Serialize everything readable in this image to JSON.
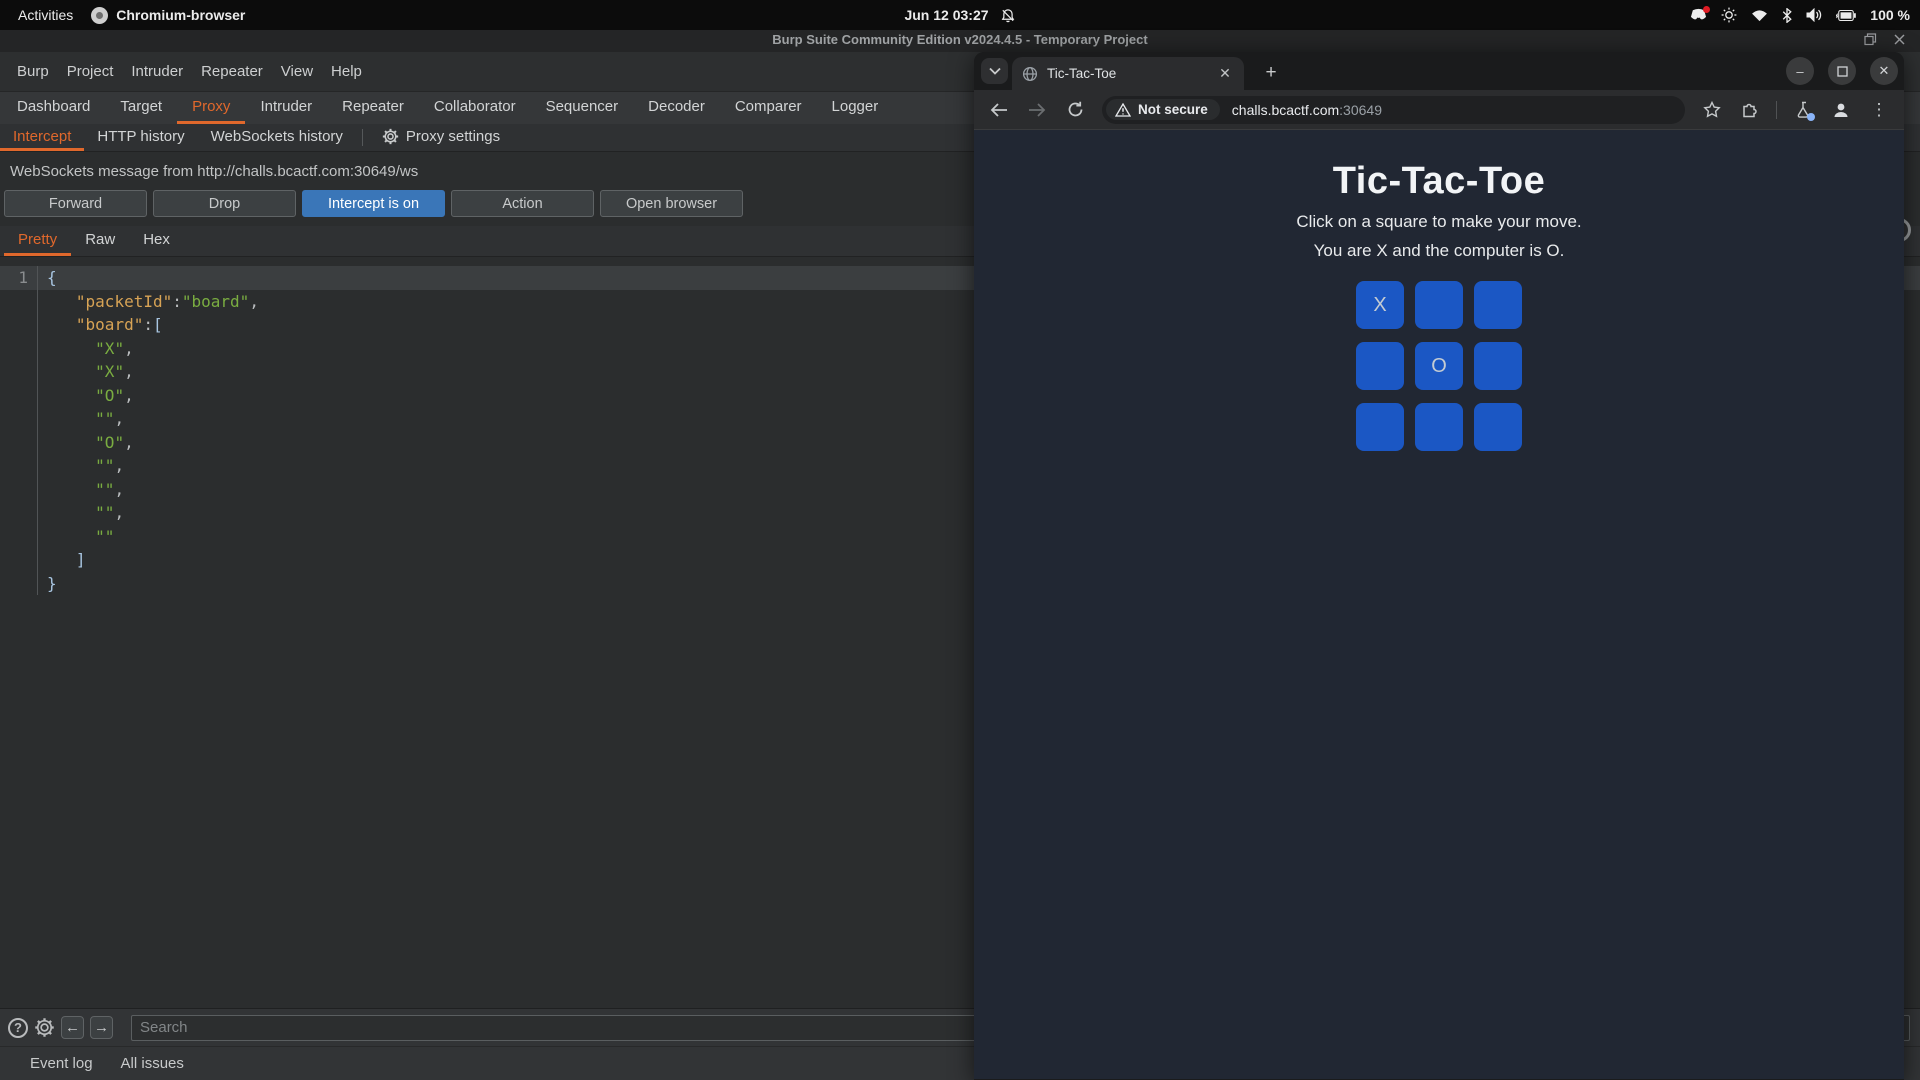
{
  "gnome_bar": {
    "activities": "Activities",
    "app_name": "Chromium-browser",
    "clock": "Jun 12 03:27",
    "battery_percent": "100 %"
  },
  "burp": {
    "window_title": "Burp Suite Community Edition v2024.4.5 - Temporary Project",
    "menu": [
      "Burp",
      "Project",
      "Intruder",
      "Repeater",
      "View",
      "Help"
    ],
    "main_tabs": [
      "Dashboard",
      "Target",
      "Proxy",
      "Intruder",
      "Repeater",
      "Collaborator",
      "Sequencer",
      "Decoder",
      "Comparer",
      "Logger"
    ],
    "active_main_tab": "Proxy",
    "sub_tabs": [
      "Intercept",
      "HTTP history",
      "WebSockets history"
    ],
    "active_sub_tab": "Intercept",
    "proxy_settings_label": "Proxy settings",
    "message_header": "WebSockets message from http://challs.bcactf.com:30649/ws",
    "buttons": {
      "forward": "Forward",
      "drop": "Drop",
      "intercept": "Intercept is on",
      "action": "Action",
      "open_browser": "Open browser"
    },
    "editor_tabs": [
      "Pretty",
      "Raw",
      "Hex"
    ],
    "active_editor_tab": "Pretty",
    "code": {
      "lines": [
        {
          "num": "1",
          "hl": true,
          "seg": [
            [
              "brace",
              "{"
            ]
          ]
        },
        {
          "seg": [
            [
              "sp",
              "   "
            ],
            [
              "key",
              "\"packetId\""
            ],
            [
              "punct",
              ":"
            ],
            [
              "str",
              "\"board\""
            ],
            [
              "punct",
              ","
            ]
          ]
        },
        {
          "seg": [
            [
              "sp",
              "   "
            ],
            [
              "key",
              "\"board\""
            ],
            [
              "punct",
              ":"
            ],
            [
              "bracket",
              "["
            ]
          ]
        },
        {
          "seg": [
            [
              "sp",
              "     "
            ],
            [
              "str",
              "\"X\""
            ],
            [
              "punct",
              ","
            ]
          ]
        },
        {
          "seg": [
            [
              "sp",
              "     "
            ],
            [
              "str",
              "\"X\""
            ],
            [
              "punct",
              ","
            ]
          ]
        },
        {
          "seg": [
            [
              "sp",
              "     "
            ],
            [
              "str",
              "\"O\""
            ],
            [
              "punct",
              ","
            ]
          ]
        },
        {
          "seg": [
            [
              "sp",
              "     "
            ],
            [
              "str",
              "\"\""
            ],
            [
              "punct",
              ","
            ]
          ]
        },
        {
          "seg": [
            [
              "sp",
              "     "
            ],
            [
              "str",
              "\"O\""
            ],
            [
              "punct",
              ","
            ]
          ]
        },
        {
          "seg": [
            [
              "sp",
              "     "
            ],
            [
              "str",
              "\"\""
            ],
            [
              "punct",
              ","
            ]
          ]
        },
        {
          "seg": [
            [
              "sp",
              "     "
            ],
            [
              "str",
              "\"\""
            ],
            [
              "punct",
              ","
            ]
          ]
        },
        {
          "seg": [
            [
              "sp",
              "     "
            ],
            [
              "str",
              "\"\""
            ],
            [
              "punct",
              ","
            ]
          ]
        },
        {
          "seg": [
            [
              "sp",
              "     "
            ],
            [
              "str",
              "\"\""
            ]
          ]
        },
        {
          "seg": [
            [
              "sp",
              "   "
            ],
            [
              "bracket",
              "]"
            ]
          ]
        },
        {
          "seg": [
            [
              "brace",
              "}"
            ]
          ]
        }
      ]
    },
    "search_placeholder": "Search",
    "event_log": "Event log",
    "all_issues": "All issues"
  },
  "chrome": {
    "tab_title": "Tic-Tac-Toe",
    "security_label": "Not secure",
    "url_host": "challs.bcactf.com",
    "url_port": ":30649",
    "page": {
      "title": "Tic-Tac-Toe",
      "instruction1": "Click on a square to make your move.",
      "instruction2": "You are X and the computer is O.",
      "board": [
        "X",
        "",
        "",
        "",
        "O",
        "",
        "",
        "",
        ""
      ]
    }
  },
  "colors": {
    "burp_accent_orange": "#e0682c",
    "burp_intercept_blue": "#3a76b8",
    "json_key": "#d7a355",
    "json_string": "#7aad41",
    "board_square_blue": "#1b57c4",
    "page_background": "#212733",
    "not_secure_text": "#e8eaed",
    "experiment_dot_blue": "#8ab4f8",
    "notification_badge_red": "#e01b24"
  }
}
